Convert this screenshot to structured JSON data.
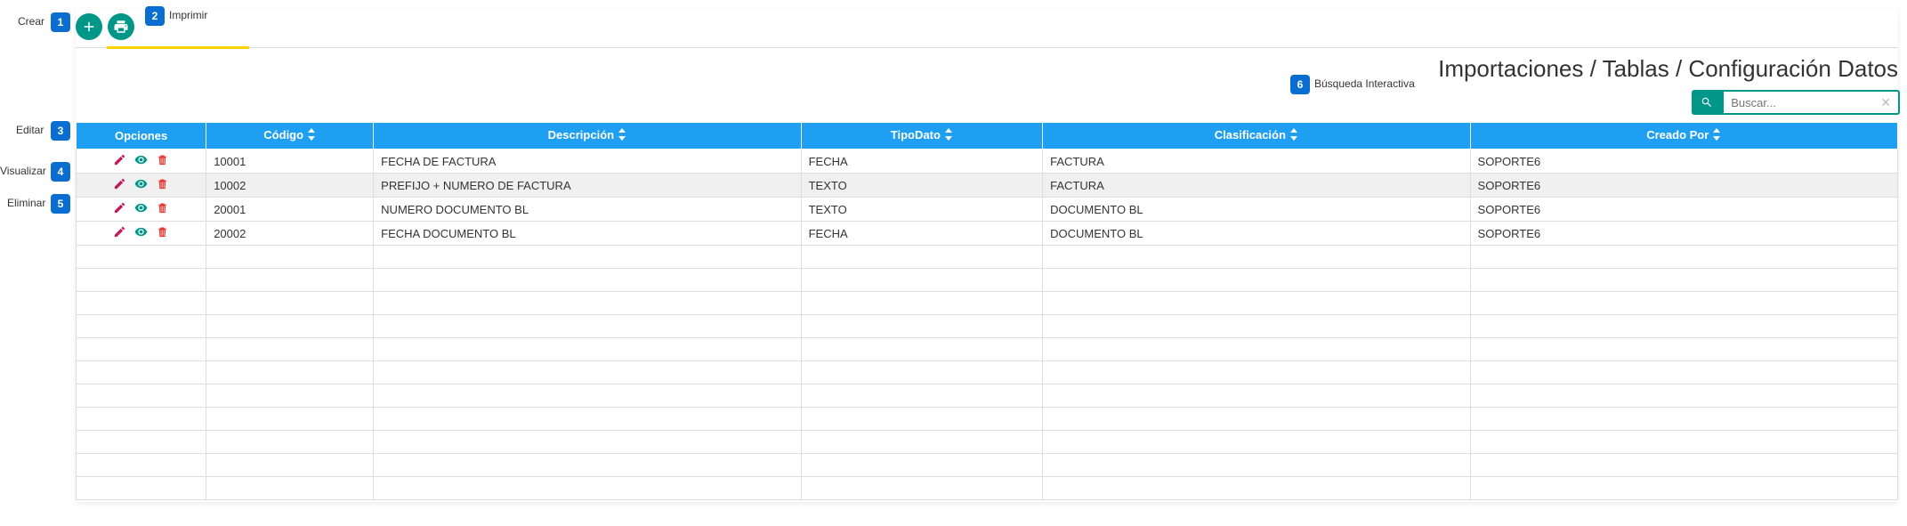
{
  "toolbar": {
    "create_label": "Crear",
    "print_label": "Imprimir"
  },
  "page_title": "Importaciones / Tablas / Configuración Datos",
  "search": {
    "placeholder": "Buscar...",
    "label": "Búsqueda Interactiva"
  },
  "callouts": {
    "c1": "1",
    "c1_label": "Crear",
    "c2": "2",
    "c2_label": "Imprimir",
    "c3": "3",
    "c3_label": "Editar",
    "c4": "4",
    "c4_label": "Visualizar",
    "c5": "5",
    "c5_label": "Eliminar",
    "c6": "6",
    "c6_label": "Búsqueda Interactiva"
  },
  "table": {
    "headers": {
      "opciones": "Opciones",
      "codigo": "Código",
      "descripcion": "Descripción",
      "tipodato": "TipoDato",
      "clasificacion": "Clasificación",
      "creadopor": "Creado Por"
    },
    "rows": [
      {
        "codigo": "10001",
        "descripcion": "FECHA DE FACTURA",
        "tipodato": "FECHA",
        "clasificacion": "FACTURA",
        "creadopor": "SOPORTE6"
      },
      {
        "codigo": "10002",
        "descripcion": "PREFIJO + NUMERO DE FACTURA",
        "tipodato": "TEXTO",
        "clasificacion": "FACTURA",
        "creadopor": "SOPORTE6"
      },
      {
        "codigo": "20001",
        "descripcion": "NUMERO DOCUMENTO BL",
        "tipodato": "TEXTO",
        "clasificacion": "DOCUMENTO BL",
        "creadopor": "SOPORTE6"
      },
      {
        "codigo": "20002",
        "descripcion": "FECHA DOCUMENTO BL",
        "tipodato": "FECHA",
        "clasificacion": "DOCUMENTO BL",
        "creadopor": "SOPORTE6"
      }
    ]
  }
}
